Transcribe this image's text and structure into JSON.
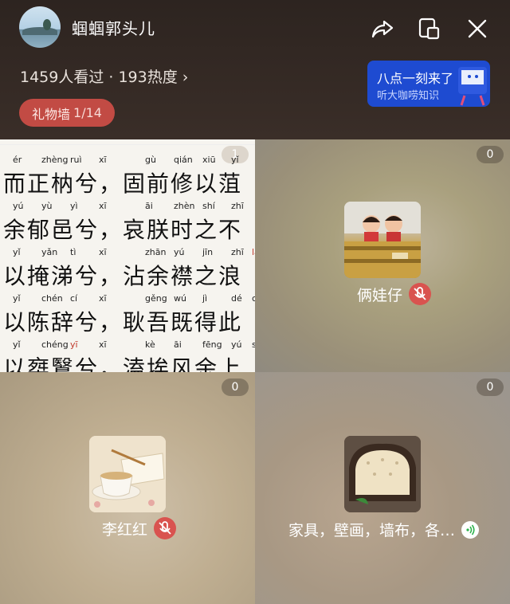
{
  "header": {
    "room_title": "蝈蝈郭头儿",
    "stats": "1459人看过 · 193热度",
    "stats_chevron": "›",
    "gift_wall_label": "礼物墙",
    "gift_wall_count": "1/14",
    "promo": {
      "line1": "八点一刻来了",
      "line2": "听大咖唠知识"
    }
  },
  "tiles": [
    {
      "badge": "1",
      "poem": [
        {
          "pinyin": [
            "ér",
            "zhèng",
            "ruì",
            "xī",
            "gù",
            "qián",
            "xiū",
            "yǐ"
          ],
          "text": "而正枘兮，固前修以菹"
        },
        {
          "pinyin": [
            "yú",
            "yù",
            "yì",
            "xī",
            "āi",
            "zhèn",
            "shí",
            "zhī"
          ],
          "text": "余郁邑兮，哀朕时之不"
        },
        {
          "pinyin": [
            "yǐ",
            "yǎn",
            "tì",
            "xī",
            "zhān",
            "yú",
            "jīn",
            "zhī",
            "láng"
          ],
          "text": "以掩涕兮，沾余襟之浪"
        },
        {
          "pinyin": [
            "yǐ",
            "chén",
            "cí",
            "xī",
            "gěng",
            "wú",
            "jì",
            "dé",
            "cǐ"
          ],
          "text": "以陈辞兮，耿吾既得此"
        },
        {
          "pinyin": [
            "yǐ",
            "chéng",
            "yī",
            "xī",
            "kè",
            "āi",
            "fēng",
            "yú",
            "shàng"
          ],
          "text": "以椉鷖兮，溘埃风余上"
        }
      ]
    },
    {
      "badge": "0",
      "name": "俩娃仔",
      "status": "muted"
    },
    {
      "badge": "0",
      "name": "李红红",
      "status": "muted"
    },
    {
      "badge": "0",
      "name": "家具，壁画，墙布，各…",
      "status": "speaking"
    }
  ]
}
